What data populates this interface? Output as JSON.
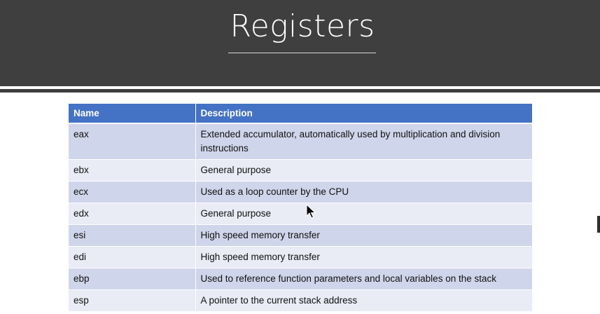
{
  "slide": {
    "title": "Registers"
  },
  "table": {
    "headers": {
      "name": "Name",
      "description": "Description"
    },
    "rows": [
      {
        "name": "eax",
        "description": "Extended accumulator, automatically used by multiplication and division instructions"
      },
      {
        "name": "ebx",
        "description": "General purpose"
      },
      {
        "name": "ecx",
        "description": "Used as a loop counter by the CPU"
      },
      {
        "name": "edx",
        "description": "General purpose"
      },
      {
        "name": "esi",
        "description": "High speed memory transfer"
      },
      {
        "name": "edi",
        "description": "High speed memory transfer"
      },
      {
        "name": "ebp",
        "description": "Used to reference function parameters and local variables on the stack"
      },
      {
        "name": "esp",
        "description": "A pointer to the current stack address"
      }
    ]
  },
  "colors": {
    "header_band": "#3f3f3f",
    "table_header": "#4472c4",
    "row_odd": "#cfd5ea",
    "row_even": "#e9ebf5"
  },
  "icons": {
    "cursor": "mouse-pointer-icon"
  }
}
